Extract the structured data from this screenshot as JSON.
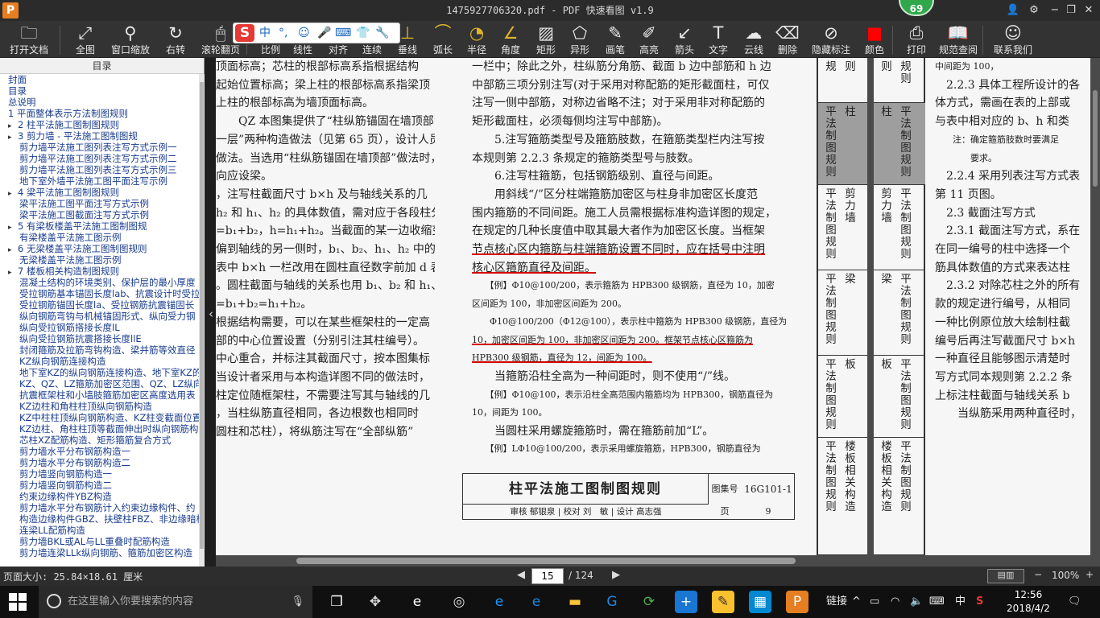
{
  "window": {
    "title": "1475927706320.pdf - PDF 快速看图 v1.9",
    "logo": "P",
    "badge": "69"
  },
  "toolbar": [
    {
      "label": "打开文档",
      "icon": "folder-icon",
      "glyph": "🗀"
    },
    {
      "label": "全图",
      "icon": "fullview-icon",
      "glyph": "⤢"
    },
    {
      "label": "窗口缩放",
      "icon": "zoom-icon",
      "glyph": "⚲"
    },
    {
      "label": "右转",
      "icon": "rotate-right-icon",
      "glyph": "↻"
    },
    {
      "label": "滚轮翻页",
      "icon": "mouse-icon",
      "glyph": "🖱"
    },
    {
      "label": "比例",
      "icon": "scale-icon",
      "glyph": "⊞"
    },
    {
      "label": "线性",
      "icon": "linear-icon",
      "glyph": "↔"
    },
    {
      "label": "对齐",
      "icon": "align-icon",
      "glyph": "⇆"
    },
    {
      "label": "连续",
      "icon": "continuous-icon",
      "glyph": "⋯"
    },
    {
      "label": "垂线",
      "icon": "perpendicular-icon",
      "glyph": "⊥"
    },
    {
      "label": "弧长",
      "icon": "arc-icon",
      "glyph": "⌒"
    },
    {
      "label": "半径",
      "icon": "radius-icon",
      "glyph": "◔"
    },
    {
      "label": "角度",
      "icon": "angle-icon",
      "glyph": "∠"
    },
    {
      "label": "矩形",
      "icon": "rectangle-icon",
      "glyph": "▨"
    },
    {
      "label": "异形",
      "icon": "polygon-icon",
      "glyph": "⬠"
    },
    {
      "label": "画笔",
      "icon": "pen-icon",
      "glyph": "✎"
    },
    {
      "label": "高亮",
      "icon": "highlight-icon",
      "glyph": "✐"
    },
    {
      "label": "箭头",
      "icon": "arrow-icon",
      "glyph": "↙"
    },
    {
      "label": "文字",
      "icon": "text-icon",
      "glyph": "T"
    },
    {
      "label": "云线",
      "icon": "cloud-icon",
      "glyph": "☁"
    },
    {
      "label": "删除",
      "icon": "eraser-icon",
      "glyph": "⌫"
    },
    {
      "label": "隐藏标注",
      "icon": "hide-icon",
      "glyph": "⊘"
    },
    {
      "label": "颜色",
      "icon": "color-icon",
      "glyph": "■"
    },
    {
      "label": "打印",
      "icon": "print-icon",
      "glyph": "⎙"
    },
    {
      "label": "规范查阅",
      "icon": "book-icon",
      "glyph": "📖"
    },
    {
      "label": "联系我们",
      "icon": "contact-icon",
      "glyph": "☺"
    }
  ],
  "ime": {
    "chars": [
      "中",
      "°,",
      "☺",
      "🎤",
      "⌨",
      "👕",
      "🔧"
    ]
  },
  "toc": {
    "heading": "目录",
    "items": [
      {
        "t": "封面",
        "top": true
      },
      {
        "t": "目录",
        "top": true
      },
      {
        "t": "总说明",
        "top": true
      },
      {
        "t": "1 平面整体表示方法制图规则",
        "top": true
      },
      {
        "t": "2 柱平法施工图制图规则",
        "top": true,
        "ex": "▸"
      },
      {
        "t": "3 剪力墙 - 平法施工图制图规",
        "top": true,
        "ex": "▸"
      },
      {
        "t": "剪力墙平法施工图列表注写方式示例一"
      },
      {
        "t": "剪力墙平法施工图列表注写方式示例二"
      },
      {
        "t": "剪力墙平法施工图列表注写方式示例三"
      },
      {
        "t": "地下室外墙平法施工图平面注写示例"
      },
      {
        "t": "4 梁平法施工图制图规则",
        "top": true,
        "ex": "▸"
      },
      {
        "t": "梁平法施工图平面注写方式示例"
      },
      {
        "t": "梁平法施工图截面注写方式示例"
      },
      {
        "t": "5 有梁板楼盖平法施工图制图规",
        "top": true,
        "ex": "▸"
      },
      {
        "t": "有梁楼盖平法施工图示例"
      },
      {
        "t": "6 无梁楼盖平法施工图制图规则",
        "top": true,
        "ex": "▸"
      },
      {
        "t": "无梁楼盖平法施工图示例"
      },
      {
        "t": "7 楼板相关构造制图规则",
        "top": true,
        "ex": "▸"
      },
      {
        "t": "混凝土结构的环境类别、保护层的最小厚度"
      },
      {
        "t": "受拉钢筋基本锚固长度lab、抗震设计时受拉"
      },
      {
        "t": "受拉钢筋锚固长度la、受拉钢筋抗震锚固长"
      },
      {
        "t": "纵向钢筋弯钩与机械锚固形式、纵向受力钢"
      },
      {
        "t": "纵向受拉钢筋搭接长度lL"
      },
      {
        "t": "纵向受拉钢筋抗震搭接长度llE"
      },
      {
        "t": "封闭箍筋及拉筋弯钩构造、梁并筋等效直径"
      },
      {
        "t": "KZ纵向钢筋连接构造"
      },
      {
        "t": "地下室KZ的纵向钢筋连接构造、地下室KZ的"
      },
      {
        "t": "KZ、QZ、LZ箍筋加密区范围、QZ、LZ纵向钢"
      },
      {
        "t": "抗震框架柱和小墙肢箍筋加密区高度选用表"
      },
      {
        "t": "KZ边柱和角柱柱顶纵向钢筋构造"
      },
      {
        "t": "KZ中柱柱顶纵向钢筋构造、KZ柱变截面位置"
      },
      {
        "t": "KZ边柱、角柱柱顶等截面伸出时纵向钢筋构"
      },
      {
        "t": "芯柱XZ配筋构造、矩形箍筋复合方式"
      },
      {
        "t": "剪力墙水平分布钢筋构造一"
      },
      {
        "t": "剪力墙水平分布钢筋构造二"
      },
      {
        "t": "剪力墙竖向钢筋构造一"
      },
      {
        "t": "剪力墙竖向钢筋构造二"
      },
      {
        "t": "约束边缘构件YBZ构造"
      },
      {
        "t": "剪力墙水平分布钢筋计入约束边缘构件、约"
      },
      {
        "t": "构造边缘构件GBZ、扶壁柱FBZ、非边缘暗柱"
      },
      {
        "t": "连梁LL配筋构造"
      },
      {
        "t": "剪力墙BKL或AL与LL重叠时配筋构造"
      },
      {
        "t": "剪力墙连梁LLk纵向钢筋、箍筋加密区构造"
      }
    ]
  },
  "page1": {
    "left": [
      "顶面标高；芯柱的根部标高系指根据结构",
      "起始位置标高；梁上柱的根部标高系指梁顶",
      "上柱的根部标高为墙顶面标高。",
      "　　QZ 本图集提供了“柱纵筋锚固在墙顶部”、“柱",
      "一层”两种构造做法（见第 65 页），设计人员应注明",
      "做法。当选用“柱纵筋锚固在墙顶部”做法时，剪力",
      "向应设梁。",
      "，注写柱截面尺寸 b×h 及与轴线关系的几",
      "h₂ 和 h₁、h₂ 的具体数值，需对应于各段柱分",
      "=b₁+b₂，h=h₁+h₂。当截面的某一边收缩变化",
      "偏到轴线的另一侧时，b₁、b₂、h₁、h₂ 中的某",
      "",
      "表中 b×h 一栏改用在圆柱直径数字前加 d 表",
      "。圆柱截面与轴线的关系也用 b₁、b₂ 和 h₁、",
      "=b₁+b₂=h₁+h₂。",
      "根据结构需要，可以在某些框架柱的一定高",
      "部的中心位置设置（分别引注其柱编号）。",
      "中心重合，并标注其截面尺寸，按本图集标",
      "当设计者采用与本构造详图不同的做法时，",
      "柱定位随框架柱，不需要注写其与轴线的几",
      "",
      "，当柱纵筋直径相同，各边根数也相同时",
      "圆柱和芯柱），将纵筋注写在“全部纵筋”"
    ],
    "right": [
      "一栏中；除此之外，柱纵筋分角筋、截面 b 边中部筋和 h 边",
      "中部筋三项分别注写(对于采用对称配筋的矩形截面柱，可仅",
      "注写一侧中部筋，对称边省略不注；对于采用非对称配筋的",
      "矩形截面柱，必须每侧均注写中部筋)。",
      "　　5.注写箍筋类型号及箍筋肢数，在箍筋类型栏内注写按",
      "本规则第 2.2.3 条规定的箍筋类型号与肢数。",
      "　　6.注写柱箍筋，包括钢筋级别、直径与间距。",
      "　　用斜线“/”区分柱端箍筋加密区与柱身非加密区长度范",
      "围内箍筋的不同间距。施工人员需根据标准构造详图的规定，",
      "在规定的几种长度值中取其最大者作为加密区长度。当框架",
      "节点核心区内箍筋与柱端箍筋设置不同时，应在括号中注明",
      "核心区箍筋直径及间距。",
      "　　【例】Φ10@100/200，表示箍筋为 HPB300 级钢筋，直径为 10，加密",
      "区间距为 100，非加密区间距为 200。",
      "　　Φ10@100/200（Φ12@100），表示柱中箍筋为 HPB300 级钢筋，直径为",
      "10，加密区间距为 100，非加密区间距为 200。框架节点核心区箍筋为",
      "HPB300 级钢筋，直径为 12，间距为 100。",
      "　　当箍筋沿柱全高为一种间距时，则不使用“/”线。",
      "　　【例】Φ10@100，表示沿柱全高范围内箍筋均为 HPB300，钢筋直径为",
      "10，间距为 100。",
      "　　当圆柱采用螺旋箍筋时，需在箍筋前加“L”。",
      "　　【例】LΦ10@100/200，表示采用螺旋箍筋，HPB300，钢筋直径为"
    ],
    "titleblock": {
      "title": "柱平法施工图制图规则",
      "atlas_label": "图集号",
      "atlas": "16G101-1",
      "page_label": "页",
      "page": "9",
      "row": "审核 郁银泉 | 校对 刘　敏 | 设计 高志强"
    },
    "tabs": [
      {
        "a": "则",
        "b": "规"
      },
      {
        "a": "柱",
        "b": "平法制图规则",
        "active": true
      },
      {
        "a": "剪力墙",
        "b": "平法制图规则"
      },
      {
        "a": "梁",
        "b": "平法制图规则"
      },
      {
        "a": "板",
        "b": "平法制图规则"
      },
      {
        "a": "楼板相关构造",
        "b": "平法制图规则"
      }
    ]
  },
  "page2": {
    "tabs": [
      {
        "a": "则",
        "b": "规则"
      },
      {
        "a": "柱",
        "b": "平法制图规则",
        "active": true
      },
      {
        "a": "剪力墙",
        "b": "平法制图规则"
      },
      {
        "a": "梁",
        "b": "平法制图规则"
      },
      {
        "a": "板",
        "b": "平法制图规则"
      },
      {
        "a": "楼板相关构造",
        "b": "平法制图规则"
      }
    ],
    "text": [
      "中间距为 100，",
      "　2.2.3 具体工程所设计的各",
      "体方式，需画在表的上部或",
      "与表中相对应的 b、h 和类",
      "　　注：确定箍筋肢数时要满足",
      "　　　　要求。",
      "　2.2.4 采用列表注写方式表",
      "第 11 页图。",
      "　2.3 截面注写方式",
      "　2.3.1 截面注写方式，系在",
      "在同一编号的柱中选择一个",
      "筋具体数值的方式来表达柱",
      "　2.3.2 对除芯柱之外的所有",
      "款的规定进行编号，从相同",
      "一种比例原位放大绘制柱截",
      "编号后再注写截面尺寸 b×h",
      "一种直径且能够图示清楚时",
      "写方式同本规则第 2.2.2 条",
      "上标注柱截面与轴线关系 b",
      "　　当纵筋采用两种直径时，"
    ]
  },
  "status": {
    "page_size": "页面大小: 25.84×18.61 厘米",
    "current_page": "15",
    "total_pages": "/ 124",
    "zoom": "100%"
  },
  "taskbar": {
    "search_placeholder": "在这里输入你要搜索的内容",
    "tray_link": "链接",
    "ime": "中",
    "time": "12:56",
    "date": "2018/4/2"
  }
}
